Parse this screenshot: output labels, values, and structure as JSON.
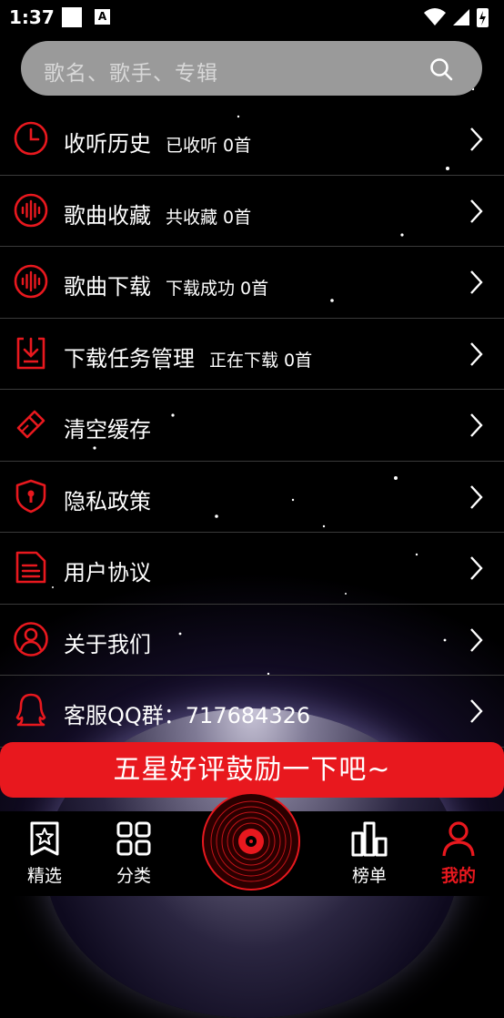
{
  "status_bar": {
    "time": "1:37",
    "notification_app": "A"
  },
  "search": {
    "placeholder": "歌名、歌手、专辑"
  },
  "menu": [
    {
      "icon": "clock-icon",
      "title": "收听历史",
      "subtitle": "已收听 0首"
    },
    {
      "icon": "favorites-icon",
      "title": "歌曲收藏",
      "subtitle": "共收藏 0首"
    },
    {
      "icon": "download-icon",
      "title": "歌曲下载",
      "subtitle": "下载成功 0首"
    },
    {
      "icon": "download-tasks-icon",
      "title": "下载任务管理",
      "subtitle": "正在下载 0首"
    },
    {
      "icon": "broom-icon",
      "title": "清空缓存",
      "subtitle": ""
    },
    {
      "icon": "shield-icon",
      "title": "隐私政策",
      "subtitle": ""
    },
    {
      "icon": "document-icon",
      "title": "用户协议",
      "subtitle": ""
    },
    {
      "icon": "user-icon",
      "title": "关于我们",
      "subtitle": ""
    },
    {
      "icon": "qq-icon",
      "title": "客服QQ群：717684326",
      "subtitle": ""
    }
  ],
  "rate_button": "五星好评鼓励一下吧~",
  "tabs": [
    {
      "icon": "star-badge-icon",
      "label": "精选"
    },
    {
      "icon": "grid-icon",
      "label": "分类"
    },
    {
      "icon": "disc-icon",
      "label": ""
    },
    {
      "icon": "chart-icon",
      "label": "榜单"
    },
    {
      "icon": "person-icon",
      "label": "我的",
      "active": true
    }
  ],
  "colors": {
    "accent": "#e8181e",
    "background": "#000000",
    "search_bg": "#9a9a9a"
  }
}
